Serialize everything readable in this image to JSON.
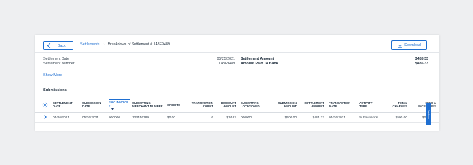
{
  "topbar": {
    "back_label": "Back",
    "breadcrumb_link": "Settlements",
    "breadcrumb_separator": "›",
    "breadcrumb_current": "Breakdown of Settlement # 148F9489",
    "download_label": "Download"
  },
  "summary": {
    "settlement_date_label": "Settlement Date",
    "settlement_date_value": "05/25/2021",
    "settlement_number_label": "Settlement Number",
    "settlement_number_value": "148F9489",
    "settlement_amount_label": "Settlement Amount",
    "settlement_amount_value": "$485.33",
    "amount_paid_label": "Amount Paid To Bank",
    "amount_paid_value": "$485.33"
  },
  "show_more_label": "Show More",
  "section_title": "Submissions",
  "table": {
    "headers": {
      "settlement_date": "Settlement Date",
      "submission_date": "Submission Date",
      "soc_invoice": "SOC Invoice #",
      "submitting_merchant_number": "Submitting Merchant Number",
      "credits": "Credits",
      "transaction_count": "Transaction Count",
      "discount_amount": "Discount Amount",
      "submitting_location_id": "Submitting Location ID",
      "submission_amount": "Submission Amount",
      "settlement_amount": "Settlement Amount",
      "transaction_date": "Transaction Date",
      "activity_type": "Activity Type",
      "total_charges": "Total Charges",
      "fees_incentives": "Fees & Incentives"
    },
    "rows": [
      {
        "settlement_date": "05/26/2021",
        "submission_date": "05/26/2021",
        "soc_invoice": "000000",
        "submitting_merchant_number": "123456789",
        "credits": "$0.00",
        "transaction_count": "6",
        "discount_amount": "$14.67",
        "submitting_location_id": "000000",
        "submission_amount": "$500.00",
        "settlement_amount": "$485.33",
        "transaction_date": "05/26/2021",
        "activity_type": "Submissions",
        "total_charges": "$500.00",
        "fees_incentives": "$0.00"
      }
    ]
  },
  "side_tab_label": "Feedback",
  "colors": {
    "accent": "#1f6fd1",
    "background": "#eeeff1",
    "card": "#ffffff"
  }
}
